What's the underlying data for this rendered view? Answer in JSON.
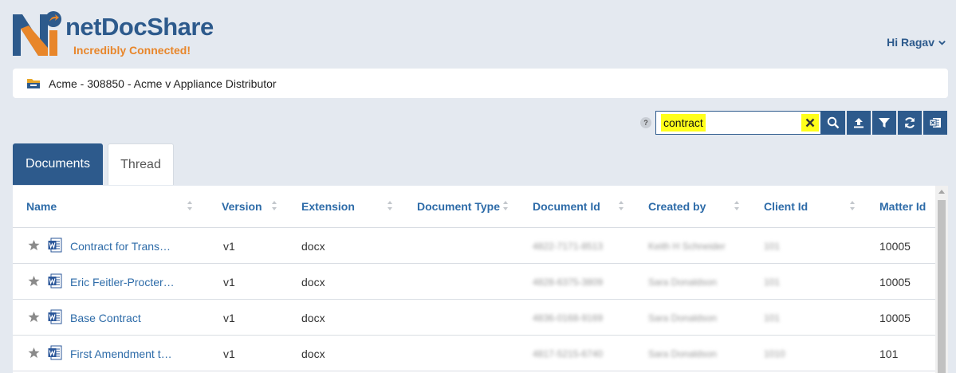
{
  "brand": {
    "name": "netDocShare",
    "tagline": "Incredibly Connected!"
  },
  "user": {
    "greeting": "Hi Ragav"
  },
  "breadcrumb": {
    "path": "Acme - 308850 - Acme v Appliance Distributor"
  },
  "search": {
    "help": "?",
    "value": "contract"
  },
  "tabs": [
    {
      "label": "Documents",
      "active": true
    },
    {
      "label": "Thread",
      "active": false
    }
  ],
  "table": {
    "columns": [
      "Name",
      "Version",
      "Extension",
      "Document Type",
      "Document Id",
      "Created by",
      "Client Id",
      "Matter Id"
    ],
    "rows": [
      {
        "name": "Contract for Trans…",
        "version": "v1",
        "extension": "docx",
        "document_type": "",
        "document_id": "4822-7171-8513",
        "created_by": "Keith H Schneider",
        "client_id": "101",
        "matter_id": "10005"
      },
      {
        "name": "Eric Feitler-Procter…",
        "version": "v1",
        "extension": "docx",
        "document_type": "",
        "document_id": "4828-6375-3809",
        "created_by": "Sara Donaldson",
        "client_id": "101",
        "matter_id": "10005"
      },
      {
        "name": "Base Contract",
        "version": "v1",
        "extension": "docx",
        "document_type": "",
        "document_id": "4836-0168-9169",
        "created_by": "Sara Donaldson",
        "client_id": "101",
        "matter_id": "10005"
      },
      {
        "name": "First Amendment t…",
        "version": "v1",
        "extension": "docx",
        "document_type": "",
        "document_id": "4817-5215-6740",
        "created_by": "Sara Donaldson",
        "client_id": "1010",
        "matter_id": "101"
      }
    ]
  },
  "colors": {
    "primary": "#2d5a8c",
    "accent": "#e8862a",
    "highlight": "#ffff1a",
    "link": "#2d6ba8"
  }
}
